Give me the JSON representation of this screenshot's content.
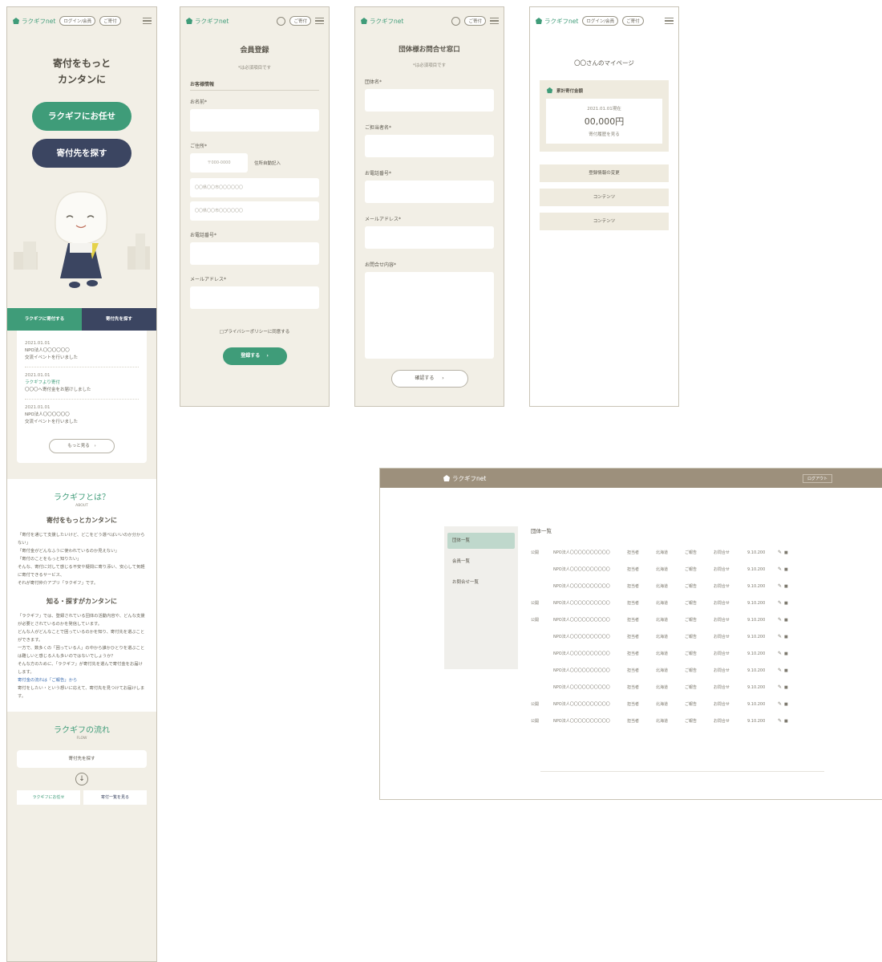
{
  "brand": "ラクギフnet",
  "colors": {
    "green": "#3f9c79",
    "navy": "#3b4561",
    "beige": "#f2efe6",
    "taupe": "#9d907c"
  },
  "home": {
    "header_pill": "ログイン/会員",
    "header_btn": "ご寄付",
    "hero_line1": "寄付をもっと",
    "hero_line2": "カンタンに",
    "cta_primary": "ラクギフにお任せ",
    "cta_secondary": "寄付先を探す",
    "tabs": [
      "ラクギフに寄付する",
      "寄付先を探す"
    ],
    "news": [
      {
        "date": "2021.01.01",
        "org": "NPO法人〇〇〇〇〇〇",
        "text": "交流イベントを行いました",
        "highlight": false
      },
      {
        "date": "2021.01.01",
        "org": "ラクギフより寄付",
        "text": "〇〇〇へ寄付金をお届けしました",
        "highlight": true
      },
      {
        "date": "2021.01.01",
        "org": "NPO法人〇〇〇〇〇〇",
        "text": "交流イベントを行いました",
        "highlight": false
      }
    ],
    "more_btn": "もっと見る",
    "about_title": "ラクギフとは？",
    "about_sub": "ABOUT",
    "about_heading": "寄付をもっとカンタンに",
    "about_paras": [
      "「寄付を通じて支援したいけど、どこをどう選べばいいのか分からない」",
      "「寄付金がどんなふうに使われているのか見えない」",
      "「寄付のことをもっと知りたい」",
      "そんな、寄付に対して感じる不安や疑問に寄り添い、安心して気軽に寄付できるサービス、",
      "それが寄付仲介アプリ「ラクギフ」です。"
    ],
    "know_heading": "知る・探すがカンタンに",
    "know_paras": [
      "「ラクギフ」では、登録されている団体の活動内容や、どんな支援が必要とされているのかを発信しています。",
      "どんな人がどんなことで困っているのかを知り、寄付先を選ぶことができます。",
      "一方で、数多くの「困っている人」の中から誰かひとりを選ぶことは難しいと感じる人も多いのではないでしょうか？",
      "そんな方のために、「ラクギフ」が寄付先を選んで寄付金をお届けします。",
      "寄付金の流れは「ご報告」から",
      "寄付をしたい・という想いに応えて、寄付先を見つけてお届けします。"
    ],
    "flow_title": "ラクギフの流れ",
    "flow_sub": "FLOW",
    "flow_step": "寄付先を探す",
    "flow_bottom": [
      "ラクギフにお任せ",
      "寄付一覧を見る"
    ]
  },
  "register": {
    "title": "会員登録",
    "required_note": "*は必須項目です",
    "section": "お客様情報",
    "labels": [
      "お名前*",
      "ご住所*",
      "お電話番号*",
      "メールアドレス*"
    ],
    "zip_placeholder": "〒000-0000",
    "auto_fill": "住所自動記入",
    "addr_placeholder1": "〇〇県〇〇市〇〇〇〇〇〇",
    "addr_placeholder2": "〇〇県〇〇市〇〇〇〇〇〇",
    "privacy": "□プライバシーポリシーに同意する",
    "submit": "登録する"
  },
  "contact": {
    "title": "団体様お問合せ窓口",
    "required_note": "*は必須項目です",
    "labels": [
      "団体名*",
      "ご担当者名*",
      "お電話番号*",
      "メールアドレス*",
      "お問合せ内容*"
    ],
    "submit": "確認する"
  },
  "mypage": {
    "title": "〇〇さんのマイページ",
    "card_heading": "累計寄付金額",
    "as_of": "2021.01.01現在",
    "amount": "00,000円",
    "card_link": "寄付履歴を見る",
    "buttons": [
      "登録情報の変更",
      "コンテンツ",
      "コンテンツ"
    ]
  },
  "admin": {
    "header_link": "ログアウト",
    "sidebar": [
      "団体一覧",
      "会員一覧",
      "お問合せ一覧"
    ],
    "table_title": "団体一覧",
    "rows": [
      {
        "flag": "公開",
        "org": "NPO法人〇〇〇〇〇〇〇〇〇〇",
        "c1": "担当者",
        "c2": "北海道",
        "c3": "ご報告",
        "c4": "お問合せ",
        "c5": "9.10.200"
      },
      {
        "flag": "",
        "org": "NPO法人〇〇〇〇〇〇〇〇〇〇",
        "c1": "担当者",
        "c2": "北海道",
        "c3": "ご報告",
        "c4": "お問合せ",
        "c5": "9.10.200"
      },
      {
        "flag": "",
        "org": "NPO法人〇〇〇〇〇〇〇〇〇〇",
        "c1": "担当者",
        "c2": "北海道",
        "c3": "ご報告",
        "c4": "お問合せ",
        "c5": "9.10.200"
      },
      {
        "flag": "公開",
        "org": "NPO法人〇〇〇〇〇〇〇〇〇〇",
        "c1": "担当者",
        "c2": "北海道",
        "c3": "ご報告",
        "c4": "お問合せ",
        "c5": "9.10.200"
      },
      {
        "flag": "公開",
        "org": "NPO法人〇〇〇〇〇〇〇〇〇〇",
        "c1": "担当者",
        "c2": "北海道",
        "c3": "ご報告",
        "c4": "お問合せ",
        "c5": "9.10.200"
      },
      {
        "flag": "",
        "org": "NPO法人〇〇〇〇〇〇〇〇〇〇",
        "c1": "担当者",
        "c2": "北海道",
        "c3": "ご報告",
        "c4": "お問合せ",
        "c5": "9.10.200"
      },
      {
        "flag": "",
        "org": "NPO法人〇〇〇〇〇〇〇〇〇〇",
        "c1": "担当者",
        "c2": "北海道",
        "c3": "ご報告",
        "c4": "お問合せ",
        "c5": "9.10.200"
      },
      {
        "flag": "",
        "org": "NPO法人〇〇〇〇〇〇〇〇〇〇",
        "c1": "担当者",
        "c2": "北海道",
        "c3": "ご報告",
        "c4": "お問合せ",
        "c5": "9.10.200"
      },
      {
        "flag": "",
        "org": "NPO法人〇〇〇〇〇〇〇〇〇〇",
        "c1": "担当者",
        "c2": "北海道",
        "c3": "ご報告",
        "c4": "お問合せ",
        "c5": "9.10.200"
      },
      {
        "flag": "公開",
        "org": "NPO法人〇〇〇〇〇〇〇〇〇〇",
        "c1": "担当者",
        "c2": "北海道",
        "c3": "ご報告",
        "c4": "お問合せ",
        "c5": "9.10.200"
      },
      {
        "flag": "公開",
        "org": "NPO法人〇〇〇〇〇〇〇〇〇〇",
        "c1": "担当者",
        "c2": "北海道",
        "c3": "ご報告",
        "c4": "お問合せ",
        "c5": "9.10.200"
      }
    ]
  }
}
